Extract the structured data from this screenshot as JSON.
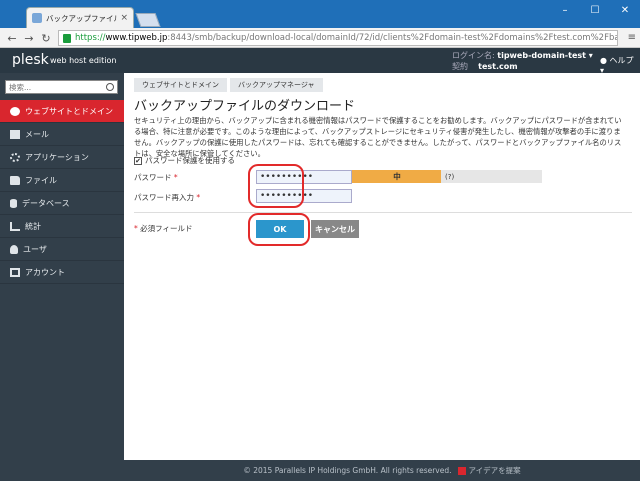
{
  "browser": {
    "tab_title": "バックアップファイルのダウンロ",
    "tab_close": "×",
    "url_https": "https://",
    "url_host": "www.tipweb.jp",
    "url_rest": ":8443/smb/backup/download-local/domainId/72/id/clients%2Fdomain-test%2Fdomains%2Ftest.com%2Fba",
    "win_min": "–",
    "win_max": "☐",
    "win_close": "✕",
    "menu_glyph": "≡"
  },
  "header": {
    "logo": "plesk",
    "logo_sub": "web host edition",
    "login_label": "ログイン名:",
    "login_value": "tipweb-domain-test ▾",
    "contract_label": "契約",
    "contract_value": "test.com",
    "help": "ヘルプ ▾"
  },
  "sidebar": {
    "search_placeholder": "検索...",
    "items": [
      {
        "label": "ウェブサイトとドメイン",
        "icon": "globe-icon"
      },
      {
        "label": "メール",
        "icon": "mail-icon"
      },
      {
        "label": "アプリケーション",
        "icon": "gear-icon"
      },
      {
        "label": "ファイル",
        "icon": "folder-icon"
      },
      {
        "label": "データベース",
        "icon": "database-icon"
      },
      {
        "label": "統計",
        "icon": "chart-icon"
      },
      {
        "label": "ユーザ",
        "icon": "user-icon"
      },
      {
        "label": "アカウント",
        "icon": "account-icon"
      }
    ]
  },
  "main": {
    "breadcrumbs": [
      "ウェブサイトとドメイン",
      "バックアップマネージャ"
    ],
    "title": "バックアップファイルのダウンロード",
    "description": "セキュリティ上の理由から、バックアップに含まれる機密情報はパスワードで保護することをお勧めします。バックアップにパスワードが含まれている場合、特に注意が必要です。このような理由によって、バックアップストレージにセキュリティ侵害が発生したし、機密情報が攻撃者の手に渡りません。バックアップの保護に使用したパスワードは、忘れても確認することができません。したがって、パスワードとバックアップファイル名のリストは、安全な場所に保管してください。",
    "protect_label": "パスワード保護を使用する",
    "protect_checked": "✔",
    "password_label": "パスワード",
    "password_value": "••••••••••",
    "password_confirm_label": "パスワード再入力",
    "password_confirm_value": "••••••••••",
    "required_star": "*",
    "strength_label": "中",
    "strength_fraction": 0.47,
    "hint": "(?)",
    "required_note": "必須フィールド",
    "ok_label": "OK",
    "cancel_label": "キャンセル"
  },
  "footer": {
    "copyright": "© 2015 Parallels IP Holdings GmbH. All rights reserved.",
    "idea": "アイデアを提案"
  },
  "colors": {
    "accent_red": "#d9262e",
    "ok_blue": "#2b96cc",
    "strength_orange": "#f0ab45",
    "sidebar_bg": "#323f4a"
  }
}
